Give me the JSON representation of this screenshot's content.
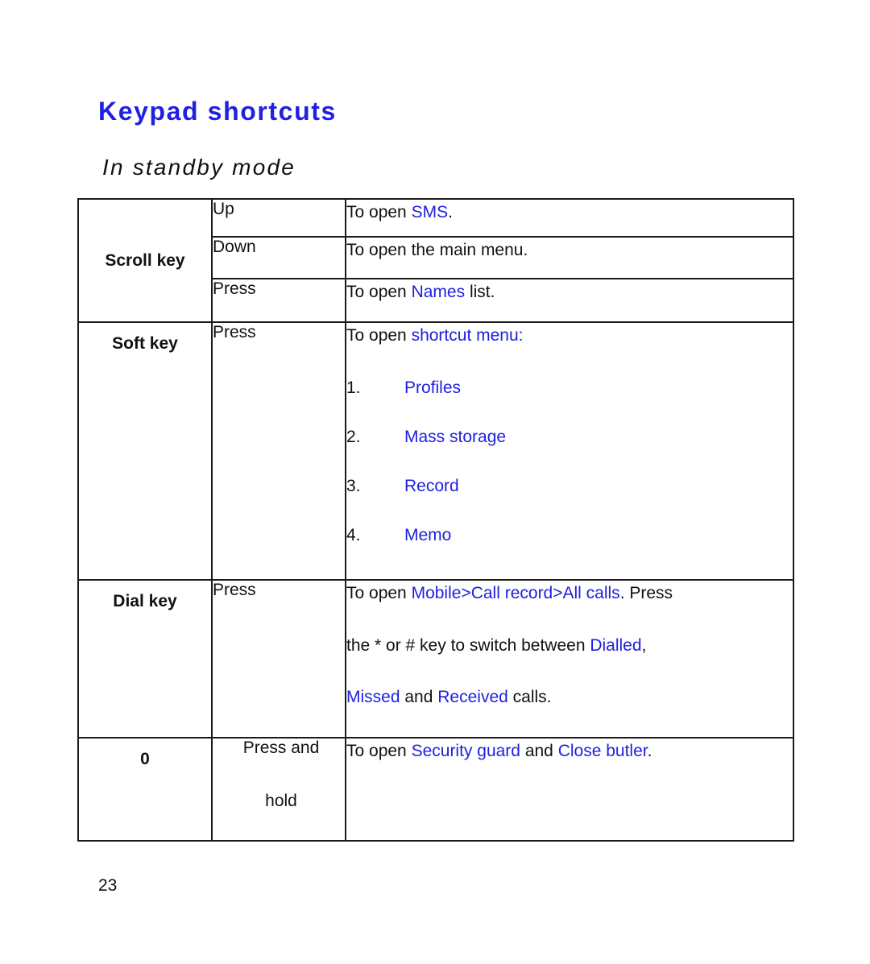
{
  "document": {
    "title": "Keypad shortcuts",
    "subtitle": "In standby mode",
    "page_number": "23",
    "accent_color": "#2020e0",
    "text_color": "#111111"
  },
  "table": {
    "rows": [
      {
        "key": "Scroll key",
        "actions": [
          {
            "action": "Up",
            "description_prefix": "To open ",
            "description_highlight": "SMS",
            "description_suffix": "."
          },
          {
            "action": "Down",
            "description_prefix": "To open the main menu.",
            "description_highlight": "",
            "description_suffix": ""
          },
          {
            "action": "Press",
            "description_prefix": "To open ",
            "description_highlight": "Names",
            "description_suffix": " list."
          }
        ]
      },
      {
        "key": "Soft key",
        "action": "Press",
        "description_prefix": "To open ",
        "description_highlight": "shortcut menu:",
        "menu_items": [
          {
            "number": "1.",
            "label": "Profiles"
          },
          {
            "number": "2.",
            "label": "Mass storage"
          },
          {
            "number": "3.",
            "label": "Record"
          },
          {
            "number": "4.",
            "label": "Memo"
          }
        ]
      },
      {
        "key": "Dial key",
        "action": "Press",
        "line1_prefix": "To open ",
        "line1_highlight": "Mobile>Call record>All calls",
        "line1_suffix": ". Press",
        "line2_prefix": "the * or # key to switch between ",
        "line2_highlight": "Dialled",
        "line2_suffix": ",",
        "line3_highlight_a": "Missed",
        "line3_middle": " and ",
        "line3_highlight_b": "Received",
        "line3_suffix": " calls."
      },
      {
        "key": "0",
        "action_line1": "Press and",
        "action_line2": "hold",
        "description_prefix": "To open ",
        "description_highlight_a": "Security guard",
        "description_middle": " and ",
        "description_highlight_b": "Close butler",
        "description_suffix": "."
      }
    ]
  }
}
